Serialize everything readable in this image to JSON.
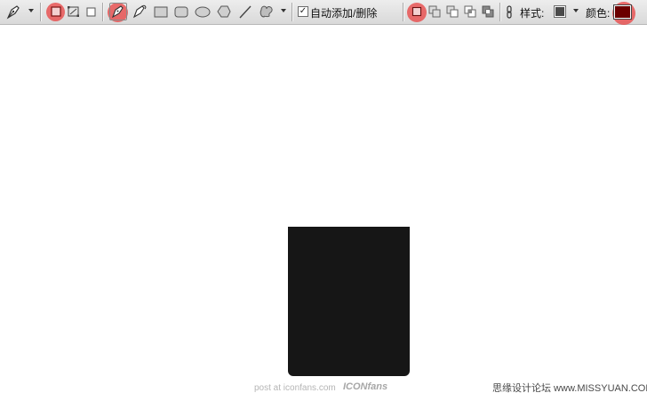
{
  "toolbar": {
    "auto_add_delete_label": "自动添加/删除",
    "auto_add_delete_checked": "✓",
    "style_label": "样式:",
    "color_label": "颜色:",
    "style_swatch_color": "#4a4a4a",
    "color_swatch_color": "#6b0000",
    "highlight_color": "#e84646",
    "icons": [
      "pen-tool-icon",
      "shape-layers-icon",
      "paths-icon",
      "fill-pixels-icon",
      "pen-icon",
      "freeform-pen-icon",
      "rectangle-icon",
      "rounded-rectangle-icon",
      "ellipse-icon",
      "polygon-icon",
      "line-icon",
      "custom-shape-icon",
      "create-new-shape-icon",
      "add-to-shape-icon",
      "subtract-shape-icon",
      "intersect-shape-icon",
      "exclude-overlap-icon",
      "link-icon"
    ]
  },
  "canvas": {
    "background": "#ffffff",
    "shape_color": "#161616"
  },
  "watermark": {
    "left": "post at iconfans.com",
    "left_logo": "ICONfans",
    "right": "思缘设计论坛 www.MISSYUAN.COM"
  }
}
